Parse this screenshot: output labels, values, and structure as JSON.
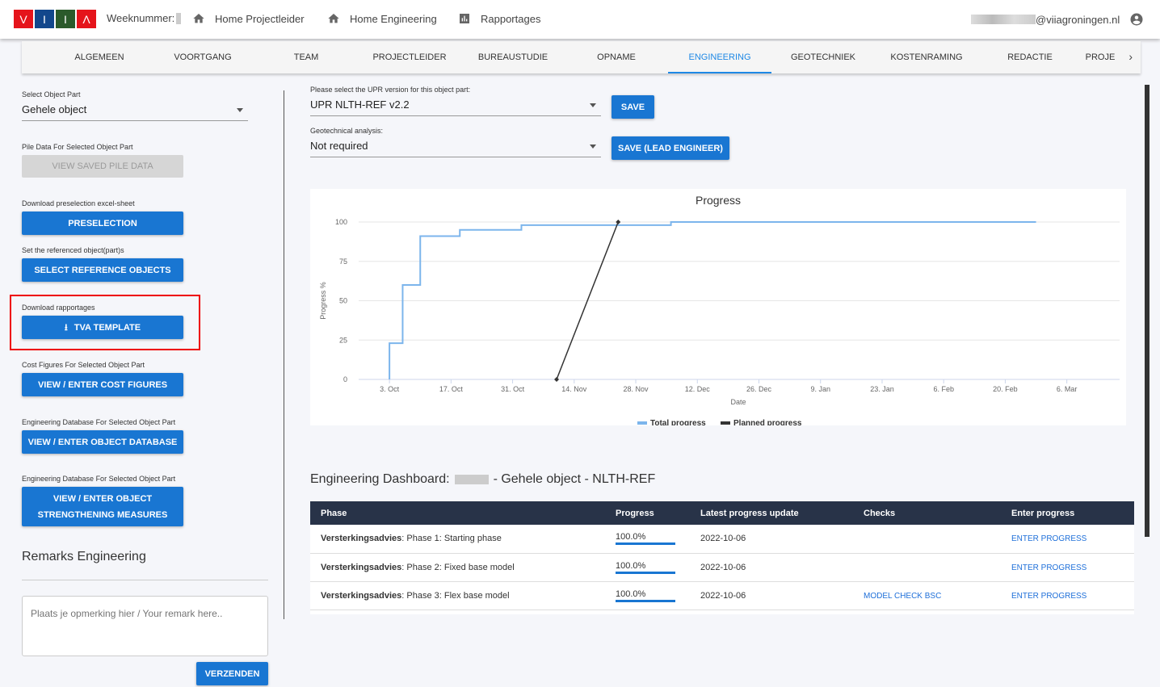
{
  "header": {
    "logo_letters": [
      "V",
      "I",
      "I",
      "Λ"
    ],
    "logo_colors": [
      "#e5141b",
      "#12478c",
      "#2b5a2b",
      "#e5141b"
    ],
    "week_label": "Weeknummer:",
    "nav": [
      {
        "label": "Home Projectleider",
        "icon": "home-icon"
      },
      {
        "label": "Home Engineering",
        "icon": "home-icon"
      },
      {
        "label": "Rapportages",
        "icon": "bar-chart-icon"
      }
    ],
    "user_email": "@viiagroningen.nl"
  },
  "tabs": [
    "ALGEMEEN",
    "VOORTGANG",
    "TEAM",
    "PROJECTLEIDER",
    "BUREAUSTUDIE",
    "OPNAME",
    "ENGINEERING",
    "GEOTECHNIEK",
    "KOSTENRAMING",
    "REDACTIE",
    "PROJE"
  ],
  "active_tab": "ENGINEERING",
  "left": {
    "select_label": "Select Object Part",
    "select_value": "Gehele object",
    "pile_label": "Pile Data For Selected Object Part",
    "pile_button": "VIEW SAVED PILE DATA",
    "presel_label": "Download preselection excel-sheet",
    "presel_button": "PRESELECTION",
    "ref_label": "Set the referenced object(part)s",
    "ref_button": "SELECT REFERENCE OBJECTS",
    "rapport_label": "Download rapportages",
    "tva_button": "TVA TEMPLATE",
    "cost_label": "Cost Figures For Selected Object Part",
    "cost_button": "VIEW / ENTER COST FIGURES",
    "db_label": "Engineering Database For Selected Object Part",
    "db_button": "VIEW / ENTER OBJECT DATABASE",
    "db2_label": "Engineering Database For Selected Object Part",
    "db2_button_1": "VIEW / ENTER OBJECT",
    "db2_button_2": "STRENGTHENING MEASURES",
    "remarks_title": "Remarks Engineering",
    "remarks_placeholder": "Plaats je opmerking hier / Your remark here..",
    "send_button": "VERZENDEN"
  },
  "upr": {
    "label": "Please select the UPR version for this object part:",
    "value": "UPR NLTH-REF v2.2",
    "save": "SAVE",
    "geo_label": "Geotechnical analysis:",
    "geo_value": "Not required",
    "save_lead": "SAVE (LEAD ENGINEER)"
  },
  "chart_data": {
    "type": "line",
    "title": "Progress",
    "xlabel": "Date",
    "ylabel": "Progress %",
    "ylim": [
      0,
      100
    ],
    "yticks": [
      0,
      25,
      50,
      75,
      100
    ],
    "xlim": [
      "2022-09-26",
      "2023-03-18"
    ],
    "xticks": [
      {
        "date": "2022-10-03",
        "label": "3. Oct"
      },
      {
        "date": "2022-10-17",
        "label": "17. Oct"
      },
      {
        "date": "2022-10-31",
        "label": "31. Oct"
      },
      {
        "date": "2022-11-14",
        "label": "14. Nov"
      },
      {
        "date": "2022-11-28",
        "label": "28. Nov"
      },
      {
        "date": "2022-12-12",
        "label": "12. Dec"
      },
      {
        "date": "2022-12-26",
        "label": "26. Dec"
      },
      {
        "date": "2023-01-09",
        "label": "9. Jan"
      },
      {
        "date": "2023-01-23",
        "label": "23. Jan"
      },
      {
        "date": "2023-02-06",
        "label": "6. Feb"
      },
      {
        "date": "2023-02-20",
        "label": "20. Feb"
      },
      {
        "date": "2023-03-06",
        "label": "6. Mar"
      }
    ],
    "grid": true,
    "legend": "bottom",
    "series": [
      {
        "name": "Total progress",
        "color": "#7cb5ec",
        "step": true,
        "points": [
          [
            "2022-10-03",
            0
          ],
          [
            "2022-10-03",
            23
          ],
          [
            "2022-10-06",
            60
          ],
          [
            "2022-10-10",
            91
          ],
          [
            "2022-10-19",
            95
          ],
          [
            "2022-11-02",
            98
          ],
          [
            "2022-12-06",
            100
          ],
          [
            "2023-02-27",
            100
          ]
        ]
      },
      {
        "name": "Planned progress",
        "color": "#333333",
        "step": false,
        "points": [
          [
            "2022-11-10",
            0
          ],
          [
            "2022-11-24",
            100
          ]
        ]
      }
    ]
  },
  "dashboard": {
    "title_prefix": "Engineering Dashboard:",
    "title_suffix": "- Gehele object - NLTH-REF",
    "columns": [
      "Phase",
      "Progress",
      "Latest progress update",
      "Checks",
      "Enter progress"
    ],
    "rows": [
      {
        "group": "Versterkingsadvies",
        "phase": ": Phase 1: Starting phase",
        "progress": "100.0%",
        "date": "2022-10-06",
        "check": "",
        "enter": "ENTER PROGRESS"
      },
      {
        "group": "Versterkingsadvies",
        "phase": ": Phase 2: Fixed base model",
        "progress": "100.0%",
        "date": "2022-10-06",
        "check": "",
        "enter": "ENTER PROGRESS"
      },
      {
        "group": "Versterkingsadvies",
        "phase": ": Phase 3: Flex base model",
        "progress": "100.0%",
        "date": "2022-10-06",
        "check": "MODEL CHECK BSC",
        "enter": "ENTER PROGRESS"
      }
    ]
  }
}
